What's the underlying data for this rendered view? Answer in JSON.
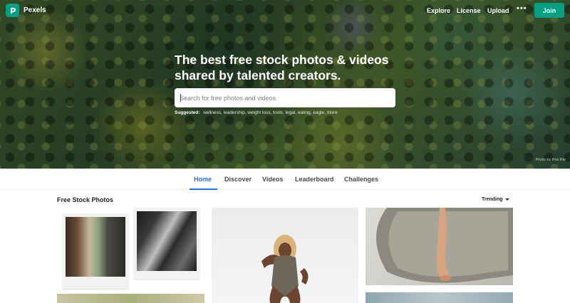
{
  "brand": {
    "name": "Pexels",
    "accent": "#05a081"
  },
  "nav": {
    "links": [
      "Explore",
      "License",
      "Upload"
    ],
    "more": "•••",
    "join_label": "Join"
  },
  "hero": {
    "headline_line1": "The best free stock photos & videos",
    "headline_line2": "shared by talented creators.",
    "search_placeholder": "Search for free photos and videos",
    "suggested_label": "Suggested:",
    "suggested_items": [
      "wellness,",
      "leadership,",
      "weight loss,",
      "tools,",
      "legal,",
      "eating,",
      "eagle,",
      "more"
    ],
    "photo_credit": "Photo by Pok Rie"
  },
  "tabs": [
    {
      "label": "Home",
      "active": true
    },
    {
      "label": "Discover",
      "active": false
    },
    {
      "label": "Videos",
      "active": false
    },
    {
      "label": "Leaderboard",
      "active": false
    },
    {
      "label": "Challenges",
      "active": false
    }
  ],
  "section": {
    "title": "Free Stock Photos",
    "sort_label": "Trending"
  },
  "icons": {
    "search": "search-icon",
    "logo": "pexels-logo-icon",
    "more": "more-dots-icon",
    "dropdown": "chevron-down-icon"
  },
  "colors": {
    "tab_active": "#1a73e8"
  }
}
